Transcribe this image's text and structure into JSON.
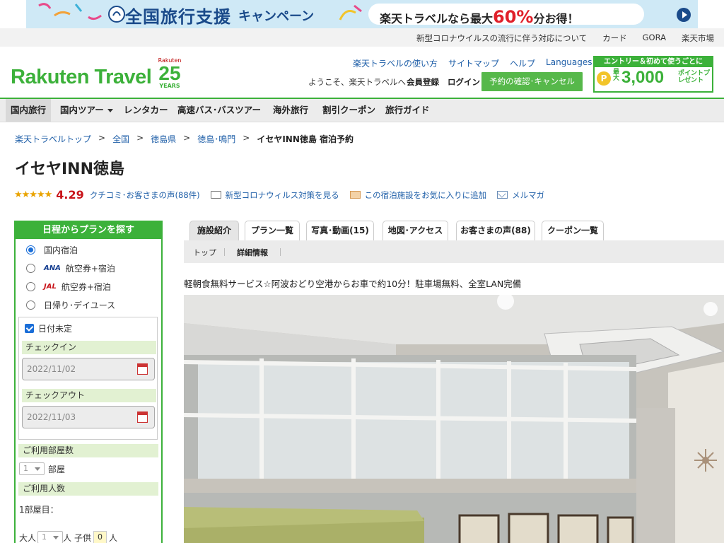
{
  "banner": {
    "title": "全国旅行支援",
    "sub": "キャンペーン",
    "promo_prefix": "楽天トラベルなら最大",
    "promo_big": "60%",
    "promo_suffix": "分お得！"
  },
  "util_links": [
    "新型コロナウイルスの流行に伴う対応について",
    "カード",
    "GORA",
    "楽天市場"
  ],
  "header": {
    "logo": "Rakuten Travel",
    "anniv_brand": "Rakuten",
    "anniv_num": "25",
    "anniv_years": "YEARS",
    "links": [
      "楽天トラベルの使い方",
      "サイトマップ",
      "ヘルプ",
      "Languages"
    ],
    "welcome": "ようこそ、楽天トラベルへ",
    "member": "会員登録",
    "login": "ログイン",
    "reserve_button": "予約の確認･キャンセル",
    "promo_top": "エントリー＆初めて使うごとに",
    "promo_pre": "最大",
    "promo_big": "3,000",
    "promo_label": "ポイントプレゼント"
  },
  "nav": [
    "国内旅行",
    "国内ツアー",
    "レンタカー",
    "高速バス･バスツアー",
    "海外旅行",
    "割引クーポン",
    "旅行ガイド"
  ],
  "breadcrumb": [
    "楽天トラベルトップ",
    "全国",
    "徳島県",
    "徳島･鳴門",
    "イセヤINN徳島 宿泊予約"
  ],
  "hotel": {
    "name": "イセヤINN徳島",
    "score": "4.29",
    "reviews_link": "クチコミ･お客さまの声(88件)",
    "covid_link": "新型コロナウィルス対策を見る",
    "fav_link": "この宿泊施設をお気に入りに追加",
    "mail_link": "メルマガ",
    "description": "軽朝食無料サービス☆阿波おどり空港からお車で約10分！駐車場無料、全室LAN完備"
  },
  "sidebar": {
    "title": "日程からプランを探す",
    "options": [
      "国内宿泊",
      "航空券+宿泊",
      "航空券+宿泊",
      "日帰り･デイユース"
    ],
    "ana": "ANA",
    "jal": "JAL",
    "undecided": "日付未定",
    "checkin_label": "チェックイン",
    "checkin": "2022/11/02",
    "checkout_label": "チェックアウト",
    "checkout": "2022/11/03",
    "rooms_label": "ご利用部屋数",
    "rooms": "1",
    "rooms_unit": "部屋",
    "people_label": "ご利用人数",
    "room1": "1部屋目：",
    "adult_label": "大人",
    "adults": "1",
    "adult_unit": "人",
    "child_label": "子供",
    "children": "0",
    "child_unit": "人"
  },
  "tabs": [
    "施設紹介",
    "プラン一覧",
    "写真･動画(15)",
    "地図･アクセス",
    "お客さまの声(88)",
    "クーポン一覧"
  ],
  "subtabs": [
    "トップ",
    "詳細情報"
  ]
}
